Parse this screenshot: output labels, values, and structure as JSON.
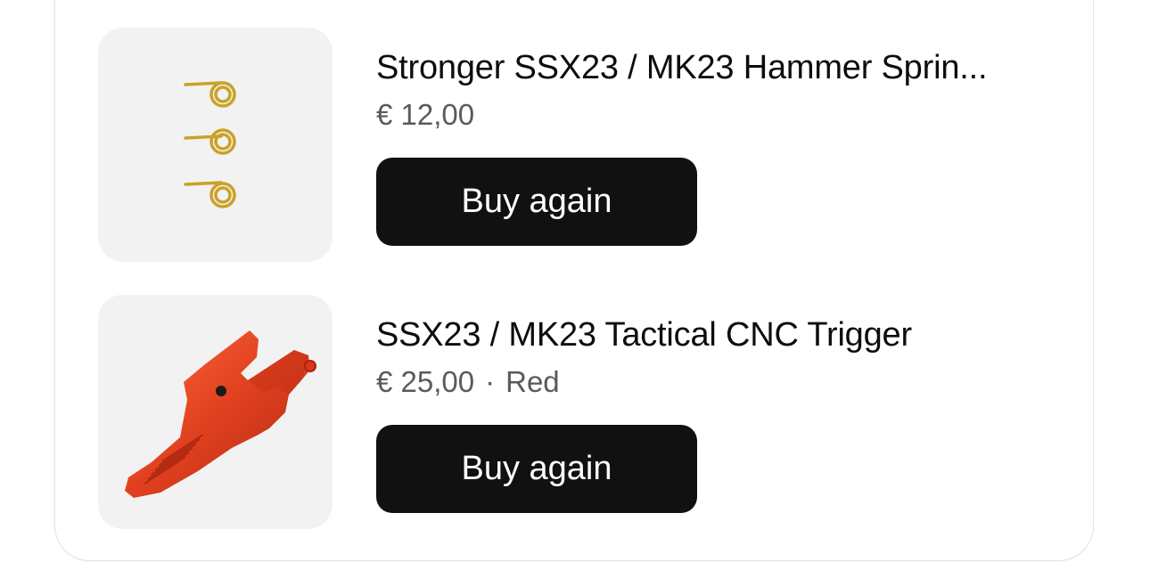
{
  "orders": {
    "items": [
      {
        "title": "Stronger SSX23 / MK23 Hammer Sprin...",
        "price": "€ 12,00",
        "variant": "",
        "button_label": "Buy again",
        "image_icon": "hammer-spring-image"
      },
      {
        "title": "SSX23 / MK23 Tactical CNC Trigger",
        "price": "€ 25,00",
        "separator": "·",
        "variant": "Red",
        "button_label": "Buy again",
        "image_icon": "cnc-trigger-image"
      }
    ]
  },
  "colors": {
    "button_bg": "#111111",
    "button_text": "#ffffff",
    "thumb_bg": "#f2f2f2",
    "spring_gold": "#c9a227",
    "trigger_red": "#e0401f"
  }
}
